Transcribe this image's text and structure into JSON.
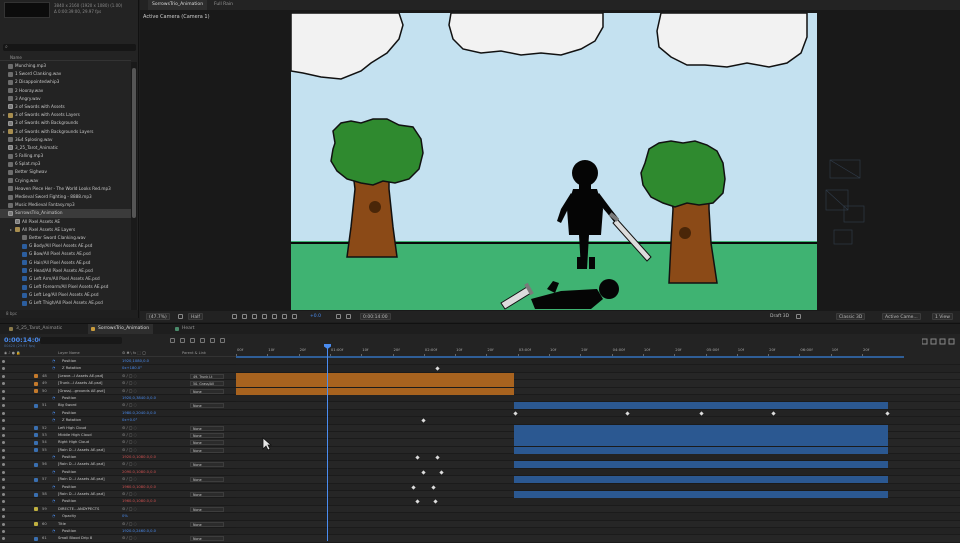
{
  "project": {
    "info_lines": [
      "3840 x 2160  (1920 x 1080) (1.00)",
      "Δ 0:00:39:00, 29.97 fps"
    ],
    "search_placeholder": "",
    "column_name": "Name",
    "items": [
      {
        "label": "Munching.mp3",
        "type": "audio",
        "indent": 0
      },
      {
        "label": "1 Sword Clanking.wav",
        "type": "audio",
        "indent": 0
      },
      {
        "label": "2 Disappointedwhip3",
        "type": "audio",
        "indent": 0
      },
      {
        "label": "2 Hooray.wav",
        "type": "audio",
        "indent": 0
      },
      {
        "label": "3 Angry.wav",
        "type": "audio",
        "indent": 0
      },
      {
        "label": "3 of Swords with Assets",
        "type": "comp",
        "indent": 0
      },
      {
        "label": "3 of Swords with Assets Layers",
        "type": "folder",
        "indent": 0,
        "arrow": true
      },
      {
        "label": "3 of Swords with Backgrounds",
        "type": "comp",
        "indent": 0
      },
      {
        "label": "3 of Swords with Backgrounds Layers",
        "type": "folder",
        "indent": 0,
        "arrow": true
      },
      {
        "label": "3&4 Splosing.wav",
        "type": "audio",
        "indent": 0
      },
      {
        "label": "3_25_Tarot_Animatic",
        "type": "comp",
        "indent": 0
      },
      {
        "label": "5 Falling.mp3",
        "type": "audio",
        "indent": 0
      },
      {
        "label": "6 Splat.mp3",
        "type": "audio",
        "indent": 0
      },
      {
        "label": "Better Sighwav",
        "type": "audio",
        "indent": 0
      },
      {
        "label": "Crying.wav",
        "type": "audio",
        "indent": 0
      },
      {
        "label": "Heaven Piece Her - The World Looks Red.mp3",
        "type": "audio",
        "indent": 0
      },
      {
        "label": "Medieval Sword Fighting - 8888.mp3",
        "type": "audio",
        "indent": 0
      },
      {
        "label": "Music Medieval Fantasy.mp3",
        "type": "audio",
        "indent": 0
      },
      {
        "label": "SorrowsTrio_Animation",
        "type": "comp",
        "indent": 0,
        "selected": true
      },
      {
        "label": "All Pixel Assets AE",
        "type": "comp",
        "indent": 1
      },
      {
        "label": "All Pixel Assets AE Layers",
        "type": "folder",
        "indent": 1,
        "arrow": true
      },
      {
        "label": "Better Sword Clanking.wav",
        "type": "audio",
        "indent": 2
      },
      {
        "label": "G Body/All Pixel Assets AE.psd",
        "type": "psd",
        "indent": 2
      },
      {
        "label": "G Bow/All Pixel Assets AE.psd",
        "type": "psd",
        "indent": 2
      },
      {
        "label": "G Hair/All Pixel Assets AE.psd",
        "type": "psd",
        "indent": 2
      },
      {
        "label": "G Head/All Pixel Assets AE.psd",
        "type": "psd",
        "indent": 2
      },
      {
        "label": "G Left Arm/All Pixel Assets AE.psd",
        "type": "psd",
        "indent": 2
      },
      {
        "label": "G Left Forearm/All Pixel Assets AE.psd",
        "type": "psd",
        "indent": 2
      },
      {
        "label": "G Left Leg/All Pixel Assets AE.psd",
        "type": "psd",
        "indent": 2
      },
      {
        "label": "G Left Thigh/All Pixel Assets AE.psd",
        "type": "psd",
        "indent": 2
      }
    ],
    "footer": "8 bpc"
  },
  "viewer": {
    "tabs": [
      "SorrowsTrio_Animation",
      "Full Rain"
    ],
    "active_camera": "Active Camera  (Camera 1)",
    "toolbar": {
      "zoom": "(47.7%)",
      "resolution": "Half",
      "exposure": "+0.0",
      "time": "0:00:14:00",
      "draft": "Draft 3D",
      "renderer": "Classic 3D",
      "camera": "Active Came...",
      "views": "1 View"
    }
  },
  "timeline": {
    "tabs": [
      {
        "label": "3_25_Tarot_Animatic",
        "color": "#8a7a4a"
      },
      {
        "label": "SorrowsTrio_Animation",
        "color": "#c89b3c",
        "active": true
      },
      {
        "label": "Heart",
        "color": "#4a8a6a"
      }
    ],
    "timecode": "0:00:14:00",
    "frame_info": "00420 (29.97 fps)",
    "columns": {
      "layer_name": "Layer Name",
      "parent": "Parent & Link"
    },
    "ruler_labels": [
      "00f",
      "10f",
      "20f",
      "01:00f",
      "10f",
      "20f",
      "02:00f",
      "10f",
      "20f",
      "03:00f",
      "10f",
      "20f",
      "04:00f",
      "10f",
      "20f",
      "05:00f",
      "10f",
      "20f",
      "06:00f",
      "10f",
      "20f"
    ],
    "layers": [
      {
        "num": "",
        "name": "Position",
        "value": "1920,1080,0.0",
        "kind": "prop"
      },
      {
        "num": "",
        "name": "Z Rotation",
        "value": "0x+180.0°",
        "kind": "prop"
      },
      {
        "num": "48",
        "name": "[Leave...l Assets AE.psd]",
        "parent": "49. Trunk Lt",
        "color": "#c47a2c",
        "kind": "layer"
      },
      {
        "num": "49",
        "name": "[Trunk...l Assets AE.psd]",
        "parent": "50. Grass/All",
        "color": "#c47a2c",
        "kind": "layer"
      },
      {
        "num": "50",
        "name": "[Grass/...grounds AE.psd]",
        "parent": "None",
        "color": "#c47a2c",
        "kind": "layer"
      },
      {
        "num": "",
        "name": "Position",
        "value": "1920,0,3840.0,0.0",
        "kind": "prop"
      },
      {
        "num": "51",
        "name": "Big Sword",
        "parent": "None",
        "color": "#3a6fb0",
        "kind": "layer"
      },
      {
        "num": "",
        "name": "Position",
        "value": "1980.0,2040.0,0.0",
        "kind": "prop"
      },
      {
        "num": "",
        "name": "Z Rotation",
        "value": "0x+0.0°",
        "kind": "prop"
      },
      {
        "num": "52",
        "name": "Left High Cloud",
        "parent": "None",
        "color": "#3a6fb0",
        "kind": "layer"
      },
      {
        "num": "53",
        "name": "Middle High Cloud",
        "parent": "None",
        "color": "#3a6fb0",
        "kind": "layer"
      },
      {
        "num": "54",
        "name": "Right High Cloud",
        "parent": "None",
        "color": "#3a6fb0",
        "kind": "layer"
      },
      {
        "num": "55",
        "name": "[Rain D...l Assets AE.psd]",
        "parent": "None",
        "color": "#3a6fb0",
        "kind": "layer"
      },
      {
        "num": "",
        "name": "Position",
        "value": "1920.0,1080.0,0.0",
        "kind": "prop",
        "red": true
      },
      {
        "num": "56",
        "name": "[Rain D...l Assets AE.psd]",
        "parent": "None",
        "color": "#3a6fb0",
        "kind": "layer"
      },
      {
        "num": "",
        "name": "Position",
        "value": "2090.0,1080.0,0.0",
        "kind": "prop",
        "red": true
      },
      {
        "num": "57",
        "name": "[Rain D...l Assets AE.psd]",
        "parent": "None",
        "color": "#3a6fb0",
        "kind": "layer"
      },
      {
        "num": "",
        "name": "Position",
        "value": "1960.0,1080.0,0.0",
        "kind": "prop",
        "red": true
      },
      {
        "num": "58",
        "name": "[Rain D...l Assets AE.psd]",
        "parent": "None",
        "color": "#3a6fb0",
        "kind": "layer"
      },
      {
        "num": "",
        "name": "Position",
        "value": "1960.0,1080.0,0.0",
        "kind": "prop",
        "red": true
      },
      {
        "num": "59",
        "name": "DIRECTE...ANDYPECTS",
        "parent": "None",
        "color": "#c0b040",
        "kind": "layer"
      },
      {
        "num": "",
        "name": "Opacity",
        "value": "0%",
        "kind": "prop"
      },
      {
        "num": "60",
        "name": "Title",
        "parent": "None",
        "color": "#c0b040",
        "kind": "layer"
      },
      {
        "num": "",
        "name": "Position",
        "value": "1920.0,2460.0,0.0",
        "kind": "prop"
      },
      {
        "num": "61",
        "name": "Small Blood Drip 8",
        "parent": "None",
        "color": "#3a6fb0",
        "kind": "layer"
      }
    ]
  },
  "colors": {
    "accent": "#4a8cf0",
    "sky": "#c4e1f0",
    "grass": "#3fb372",
    "orange_bar": "#a8631f",
    "blue_bar": "#2b5891",
    "green_line": "#3cb043"
  }
}
